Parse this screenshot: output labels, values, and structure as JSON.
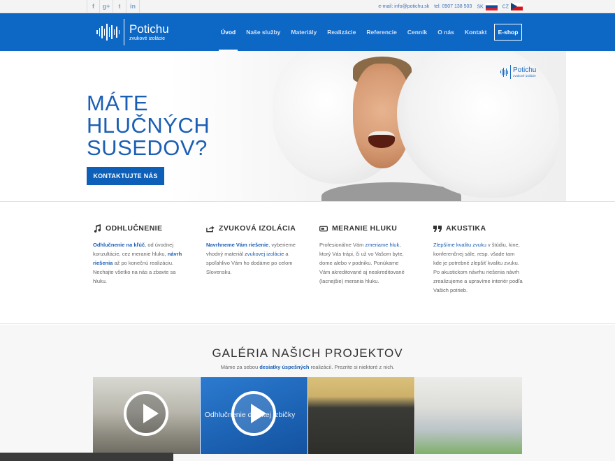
{
  "topbar": {
    "socials": [
      {
        "icon": "facebook-icon",
        "glyph": "f"
      },
      {
        "icon": "google-plus-icon",
        "glyph": "g+"
      },
      {
        "icon": "twitter-icon",
        "glyph": "t"
      },
      {
        "icon": "linkedin-icon",
        "glyph": "in"
      }
    ],
    "email": "e-mail: info@potichu.sk",
    "phone": "tel: 0907 138 503",
    "lang_sk": "SK",
    "lang_cz": "CZ"
  },
  "header": {
    "logo_name": "Potichu",
    "logo_sub": "zvukové izolácie",
    "nav": [
      "Úvod",
      "Naše služby",
      "Materiály",
      "Realizácie",
      "Referencie",
      "Cenník",
      "O nás",
      "Kontakt"
    ],
    "eshop": "E-shop",
    "brand_color": "#0d67c5"
  },
  "hero": {
    "headline": [
      "MÁTE",
      "HLUČNÝCH",
      "SUSEDOV?"
    ],
    "cta": "KONTAKTUJTE NÁS",
    "badge_name": "Potichu",
    "badge_sub": "zvukové izolácie"
  },
  "features": [
    {
      "icon": "music-note-icon",
      "title": "ODHLUČNENIE",
      "parts": [
        {
          "t": "Odhlučnenie na kľúč",
          "s": "bold"
        },
        {
          "t": ", od úvodnej konzultácie, cez meranie hluku, "
        },
        {
          "t": "návrh riešenia",
          "s": "bold"
        },
        {
          "t": " až po konečnú realizáciu. Nechajte všetko na nás a zbavte sa hluku."
        }
      ]
    },
    {
      "icon": "share-icon",
      "title": "ZVUKOVÁ IZOLÁCIA",
      "parts": [
        {
          "t": "Navrhneme Vám riešenie",
          "s": "bold"
        },
        {
          "t": ", vyberieme vhodný materiál "
        },
        {
          "t": "zvukovej izolácie",
          "s": "link"
        },
        {
          "t": " a spoľahlivo Vám ho dodáme po celom Slovensku."
        }
      ]
    },
    {
      "icon": "meter-icon",
      "title": "MERANIE HLUKU",
      "parts": [
        {
          "t": "Profesionálne Vám "
        },
        {
          "t": "zmeriame hluk",
          "s": "link"
        },
        {
          "t": ", ktorý Vás trápi, či už vo Vašom byte, dome alebo v podniku. Ponúkame Vám akreditované aj neakreditované (lacnejšie) merania hluku."
        }
      ]
    },
    {
      "icon": "quote-icon",
      "title": "AKUSTIKA",
      "parts": [
        {
          "t": "Zlepšíme kvalitu zvuku",
          "s": "link"
        },
        {
          "t": " v štúdiu, kine, konferenčnej sále, resp. všade tam kde je potrebné zlepšiť kvalitu zvuku. Po akustickom návrhu riešenia návrh zrealizujeme a upravíme interiér podľa Vašich potrieb."
        }
      ]
    }
  ],
  "gallery": {
    "title": "GALÉRIA NAŠICH PROJEKTOV",
    "sub_pre": "Máme za sebou ",
    "sub_hl": "desiatky úspešných",
    "sub_post": " realizácií. Prezrite si niektoré z nich.",
    "tiles": [
      {
        "caption": "",
        "play": true
      },
      {
        "caption": "Odhlučnenie detskej izbičky",
        "play": true
      },
      {
        "caption": "",
        "play": false
      },
      {
        "caption": "",
        "play": false
      }
    ]
  }
}
